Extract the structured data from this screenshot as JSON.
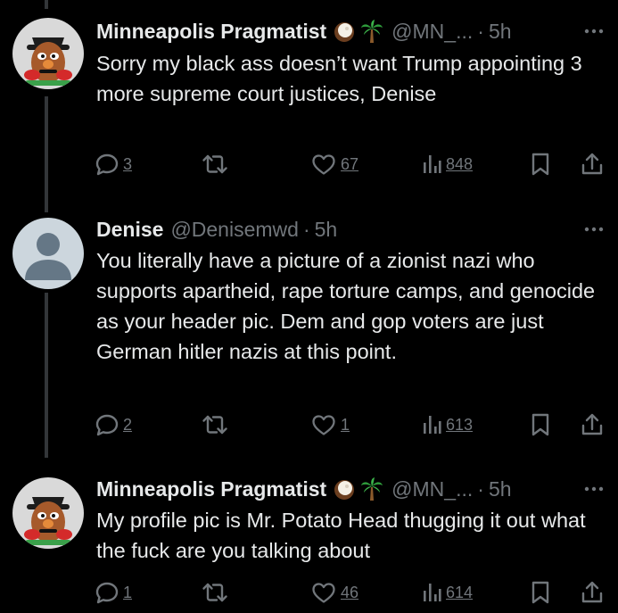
{
  "thread": {
    "tweets": [
      {
        "name": "Minneapolis Pragmatist",
        "handle": "@MN_...",
        "dot": "·",
        "time": "5h",
        "text": "Sorry my black ass doesn’t want Trump appointing 3 more supreme court justices, Denise",
        "replies": "3",
        "likes": "67",
        "views": "848"
      },
      {
        "name": "Denise",
        "handle": "@Denisemwd",
        "dot": "·",
        "time": "5h",
        "text": "You literally have a picture of a zionist nazi who supports apartheid, rape torture camps, and genocide as your header pic. Dem and gop voters are just German hitler nazis at this point.",
        "replies": "2",
        "likes": "1",
        "views": "613"
      },
      {
        "name": "Minneapolis Pragmatist",
        "handle": "@MN_...",
        "dot": "·",
        "time": "5h",
        "text": "My profile pic is Mr. Potato Head thugging it out what the fuck are you talking about",
        "replies": "1",
        "likes": "46",
        "views": "614"
      }
    ]
  },
  "icons": {
    "avatar_1": "mr-potato-head-avatar",
    "avatar_2": "default-profile-avatar",
    "emoji_1": "coconut-emoji",
    "emoji_2": "palm-tree-emoji",
    "reply": "reply-icon",
    "retweet": "retweet-icon",
    "like": "heart-icon",
    "views": "views-icon",
    "bookmark": "bookmark-icon",
    "share": "share-icon",
    "more": "more-icon"
  },
  "colors": {
    "background": "#000000",
    "text": "#e7e9ea",
    "muted": "#71767b",
    "rail": "#333639"
  }
}
